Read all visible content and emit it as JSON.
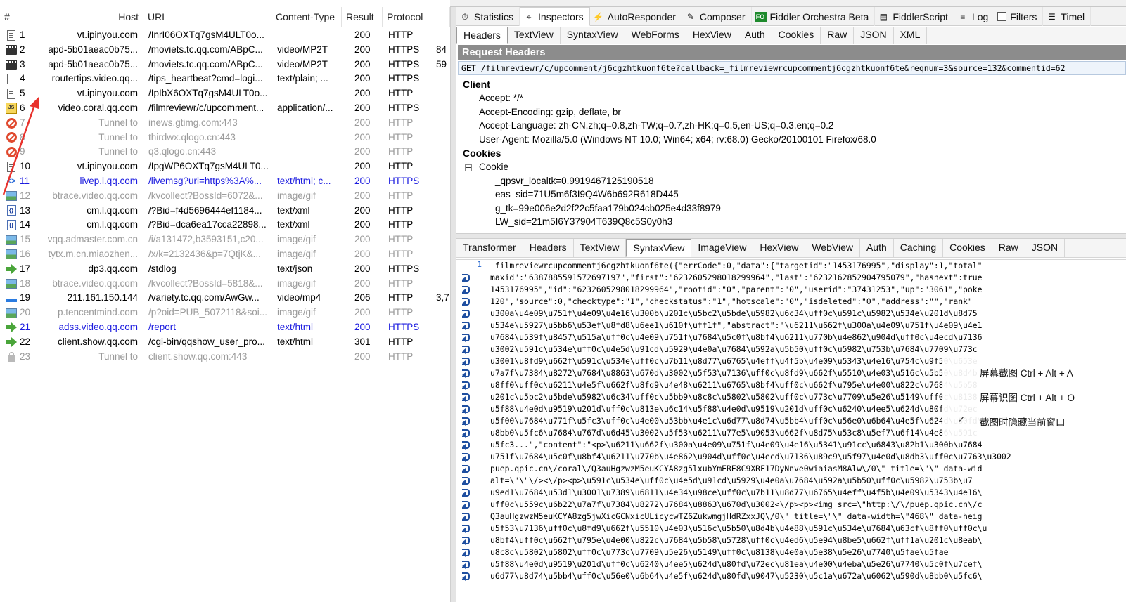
{
  "sessions": {
    "columns": [
      "#",
      "Host",
      "URL",
      "Content-Type",
      "Result",
      "Protocol"
    ],
    "rows": [
      {
        "icon": "document-icon",
        "num": "1",
        "host": "vt.ipinyou.com",
        "url": "/InrI06OXTq7gsM4ULT0o...",
        "ct": "",
        "result": "200",
        "proto": "HTTP",
        "extra": "",
        "state": "normal"
      },
      {
        "icon": "video-icon",
        "num": "2",
        "host": "apd-5b01aeac0b75...",
        "url": "/moviets.tc.qq.com/ABpC...",
        "ct": "video/MP2T",
        "result": "200",
        "proto": "HTTPS",
        "extra": "84",
        "state": "normal"
      },
      {
        "icon": "video-icon",
        "num": "3",
        "host": "apd-5b01aeac0b75...",
        "url": "/moviets.tc.qq.com/ABpC...",
        "ct": "video/MP2T",
        "result": "200",
        "proto": "HTTPS",
        "extra": "59",
        "state": "normal"
      },
      {
        "icon": "document-icon",
        "num": "4",
        "host": "routertips.video.qq...",
        "url": "/tips_heartbeat?cmd=logi...",
        "ct": "text/plain; ...",
        "result": "200",
        "proto": "HTTPS",
        "extra": "",
        "state": "normal"
      },
      {
        "icon": "document-icon",
        "num": "5",
        "host": "vt.ipinyou.com",
        "url": "/IpIbX6OXTq7gsM4ULT0o...",
        "ct": "",
        "result": "200",
        "proto": "HTTP",
        "extra": "",
        "state": "normal"
      },
      {
        "icon": "javascript-icon",
        "num": "6",
        "host": "video.coral.qq.com",
        "url": "/filmreviewr/c/upcomment...",
        "ct": "application/...",
        "result": "200",
        "proto": "HTTPS",
        "extra": "",
        "state": "selected"
      },
      {
        "icon": "blocked-icon",
        "num": "7",
        "host": "Tunnel to",
        "url": "inews.gtimg.com:443",
        "ct": "",
        "result": "200",
        "proto": "HTTP",
        "extra": "",
        "state": "muted"
      },
      {
        "icon": "blocked-icon",
        "num": "8",
        "host": "Tunnel to",
        "url": "thirdwx.qlogo.cn:443",
        "ct": "",
        "result": "200",
        "proto": "HTTP",
        "extra": "",
        "state": "muted"
      },
      {
        "icon": "blocked-icon",
        "num": "9",
        "host": "Tunnel to",
        "url": "q3.qlogo.cn:443",
        "ct": "",
        "result": "200",
        "proto": "HTTP",
        "extra": "",
        "state": "muted"
      },
      {
        "icon": "document-icon",
        "num": "10",
        "host": "vt.ipinyou.com",
        "url": "/IpgWP6OXTq7gsM4ULT0...",
        "ct": "",
        "result": "200",
        "proto": "HTTP",
        "extra": "",
        "state": "normal"
      },
      {
        "icon": "html-icon",
        "num": "11",
        "host": "livep.l.qq.com",
        "url": "/livemsg?url=https%3A%...",
        "ct": "text/html; c...",
        "result": "200",
        "proto": "HTTPS",
        "extra": "",
        "state": "blue"
      },
      {
        "icon": "image-icon",
        "num": "12",
        "host": "btrace.video.qq.com",
        "url": "/kvcollect?BossId=6072&...",
        "ct": "image/gif",
        "result": "200",
        "proto": "HTTP",
        "extra": "",
        "state": "muted"
      },
      {
        "icon": "xml-icon",
        "num": "13",
        "host": "cm.l.qq.com",
        "url": "/?Bid=f4d5696444ef1184...",
        "ct": "text/xml",
        "result": "200",
        "proto": "HTTP",
        "extra": "",
        "state": "normal"
      },
      {
        "icon": "xml-icon",
        "num": "14",
        "host": "cm.l.qq.com",
        "url": "/?Bid=dca6ea17cca22898...",
        "ct": "text/xml",
        "result": "200",
        "proto": "HTTP",
        "extra": "",
        "state": "normal"
      },
      {
        "icon": "image-icon",
        "num": "15",
        "host": "vqq.admaster.com.cn",
        "url": "/i/a131472,b3593151,c20...",
        "ct": "image/gif",
        "result": "200",
        "proto": "HTTP",
        "extra": "",
        "state": "muted"
      },
      {
        "icon": "image-icon",
        "num": "16",
        "host": "tytx.m.cn.miaozhen...",
        "url": "/x/k=2132436&p=7QtjK&...",
        "ct": "image/gif",
        "result": "200",
        "proto": "HTTP",
        "extra": "",
        "state": "muted"
      },
      {
        "icon": "arrow-icon",
        "num": "17",
        "host": "dp3.qq.com",
        "url": "/stdlog",
        "ct": "text/json",
        "result": "200",
        "proto": "HTTPS",
        "extra": "",
        "state": "normal"
      },
      {
        "icon": "image-icon",
        "num": "18",
        "host": "btrace.video.qq.com",
        "url": "/kvcollect?BossId=5818&...",
        "ct": "image/gif",
        "result": "200",
        "proto": "HTTP",
        "extra": "",
        "state": "muted"
      },
      {
        "icon": "media-icon",
        "num": "19",
        "host": "211.161.150.144",
        "url": "/variety.tc.qq.com/AwGw...",
        "ct": "video/mp4",
        "result": "206",
        "proto": "HTTP",
        "extra": "3,7",
        "state": "normal"
      },
      {
        "icon": "image-icon",
        "num": "20",
        "host": "p.tencentmind.com",
        "url": "/p?oid=PUB_5072118&soi...",
        "ct": "image/gif",
        "result": "200",
        "proto": "HTTP",
        "extra": "",
        "state": "muted"
      },
      {
        "icon": "arrow-icon",
        "num": "21",
        "host": "adss.video.qq.com",
        "url": "/report",
        "ct": "text/html",
        "result": "200",
        "proto": "HTTPS",
        "extra": "",
        "state": "blue"
      },
      {
        "icon": "arrow-icon",
        "num": "22",
        "host": "client.show.qq.com",
        "url": "/cgi-bin/qqshow_user_pro...",
        "ct": "text/html",
        "result": "301",
        "proto": "HTTP",
        "extra": "",
        "state": "normal"
      },
      {
        "icon": "lock-icon",
        "num": "23",
        "host": "Tunnel to",
        "url": "client.show.qq.com:443",
        "ct": "",
        "result": "200",
        "proto": "HTTP",
        "extra": "",
        "state": "muted"
      }
    ]
  },
  "main_tabs": [
    {
      "label": "Statistics",
      "icon": "stopwatch-icon",
      "active": false
    },
    {
      "label": "Inspectors",
      "icon": "inspect-icon",
      "active": true
    },
    {
      "label": "AutoResponder",
      "icon": "lightning-icon",
      "active": false
    },
    {
      "label": "Composer",
      "icon": "pencil-icon",
      "active": false
    },
    {
      "label": "Fiddler Orchestra Beta",
      "icon": "fo-icon",
      "active": false
    },
    {
      "label": "FiddlerScript",
      "icon": "script-icon",
      "active": false
    },
    {
      "label": "Log",
      "icon": "log-icon",
      "active": false
    },
    {
      "label": "Filters",
      "icon": "checkbox-icon",
      "active": false
    },
    {
      "label": "Timel",
      "icon": "timeline-icon",
      "active": false
    }
  ],
  "request_tabs": [
    "Headers",
    "TextView",
    "SyntaxView",
    "WebForms",
    "HexView",
    "Auth",
    "Cookies",
    "Raw",
    "JSON",
    "XML"
  ],
  "request": {
    "title": "Request Headers",
    "request_line": "GET /filmreviewr/c/upcomment/j6cgzhtkuonf6te?callback=_filmreviewrcupcommentj6cgzhtkuonf6te&reqnum=3&source=132&commentid=62",
    "client_title": "Client",
    "client_headers": [
      "Accept: */*",
      "Accept-Encoding: gzip, deflate, br",
      "Accept-Language: zh-CN,zh;q=0.8,zh-TW;q=0.7,zh-HK;q=0.5,en-US;q=0.3,en;q=0.2",
      "User-Agent: Mozilla/5.0 (Windows NT 10.0; Win64; x64; rv:68.0) Gecko/20100101 Firefox/68.0"
    ],
    "cookies_title": "Cookies",
    "cookie_node": "Cookie",
    "cookies": [
      "_qpsvr_localtk=0.9919467125190518",
      "eas_sid=71U5m6f3I9Q4W6b692R618D445",
      "g_tk=99e006e2d2f22c5faa179b024cb025e4d33f8979",
      "LW_sid=21m5I6Y37904T639Q8c5S0y0h3"
    ]
  },
  "response_tabs": [
    "Transformer",
    "Headers",
    "TextView",
    "SyntaxView",
    "ImageView",
    "HexView",
    "WebView",
    "Auth",
    "Caching",
    "Cookies",
    "Raw",
    "JSON"
  ],
  "response_active_tab": "SyntaxView",
  "response_lines": [
    "_filmreviewrcupcommentj6cgzhtkuonf6te({\"errCode\":0,\"data\":{\"targetid\":\"1453176995\",\"display\":1,\"total\"",
    "maxid\":\"6387885591572697197\",\"first\":\"6232605298018299964\",\"last\":\"6232162852904795079\",\"hasnext\":true",
    "1453176995\",\"id\":\"6232605298018299964\",\"rootid\":\"0\",\"parent\":\"0\",\"userid\":\"37431253\",\"up\":\"3061\",\"poke",
    "120\",\"source\":0,\"checktype\":\"1\",\"checkstatus\":\"1\",\"hotscale\":\"0\",\"isdeleted\":\"0\",\"address\":\"\",\"rank\"",
    "u300a\\u4e09\\u751f\\u4e09\\u4e16\\u300b\\u201c\\u5bc2\\u5bde\\u5982\\u6c34\\uff0c\\u591c\\u5982\\u534e\\u201d\\u8d75",
    "u534e\\u5927\\u5bb6\\u53ef\\u8fd8\\u6ee1\\u610f\\uff1f\",\"abstract\":\"\\u6211\\u662f\\u300a\\u4e09\\u751f\\u4e09\\u4e1",
    "u7684\\u539f\\u8457\\u515a\\uff0c\\u4e09\\u751f\\u7684\\u5c0f\\u8bf4\\u6211\\u770b\\u4e862\\u904d\\uff0c\\u4ecd\\u7136",
    "u3002\\u591c\\u534e\\uff0c\\u4e5d\\u91cd\\u5929\\u4e0a\\u7684\\u592a\\u5b50\\uff0c\\u5982\\u753b\\u7684\\u7709\\u773c",
    "u3001\\u8fd9\\u662f\\u591c\\u534e\\uff0c\\u7b11\\u8d77\\u6765\\u4eff\\u4f5b\\u4e09\\u5343\\u4e16\\u754c\\u9f50\\u653e",
    "u7a7f\\u7384\\u8272\\u7684\\u8863\\u670d\\u3002\\u5f53\\u7136\\uff0c\\u8fd9\\u662f\\u5510\\u4e03\\u516c\\u5b50\\u8d4b",
    "u8ff0\\uff0c\\u6211\\u4e5f\\u662f\\u8fd9\\u4e48\\u6211\\u6765\\u8bf4\\uff0c\\u662f\\u795e\\u4e00\\u822c\\u7684\\u5b58",
    "u201c\\u5bc2\\u5bde\\u5982\\u6c34\\uff0c\\u5bb9\\u8c8c\\u5802\\u5802\\uff0c\\u773c\\u7709\\u5e26\\u5149\\uff0c\\u8138",
    "u5f88\\u4e0d\\u9519\\u201d\\uff0c\\u813e\\u6c14\\u5f88\\u4e0d\\u9519\\u201d\\uff0c\\u6240\\u4ee5\\u624d\\u80fd\\u72ec",
    "u5f00\\u7684\\u771f\\u5fc3\\uff0c\\u4e00\\u53bb\\u4e1c\\u6d77\\u8d74\\u5bb4\\uff0c\\u56e0\\u6b64\\u4e5f\\u624d\\u80fd\\u9047",
    "u8bb0\\u5fc6\\u7684\\u767d\\u6d45\\u3002\\u5f53\\u6211\\u77e5\\u9053\\u662f\\u8d75\\u53c8\\u5ef7\\u6f14\\u4e86\\u591c",
    "u5fc3...\",\"content\":\"<p>\\u6211\\u662f\\u300a\\u4e09\\u751f\\u4e09\\u4e16\\u5341\\u91cc\\u6843\\u82b1\\u300b\\u7684",
    "u751f\\u7684\\u5c0f\\u8bf4\\u6211\\u770b\\u4e862\\u904d\\uff0c\\u4ecd\\u7136\\u89c9\\u5f97\\u4e0d\\u8db3\\uff0c\\u7763\\u3002",
    "puep.qpic.cn\\/coral\\/Q3auHgzwzM5euKCYA8zg5lxubYmERE8C9XRF17DyNnve0wiaiasM8Alw\\/0\\\" title=\\\"\\\" data-wid",
    " alt=\\\"\\\"\\/><\\/p><p>\\u591c\\u534e\\uff0c\\u4e5d\\u91cd\\u5929\\u4e0a\\u7684\\u592a\\u5b50\\uff0c\\u5982\\u753b\\u7",
    "u9ed1\\u7684\\u53d1\\u3001\\u7389\\u6811\\u4e34\\u98ce\\uff0c\\u7b11\\u8d77\\u6765\\u4eff\\u4f5b\\u4e09\\u5343\\u4e16\\",
    "uff0c\\u559c\\u6b22\\u7a7f\\u7384\\u8272\\u7684\\u8863\\u670d\\u3002<\\/p><p><img src=\\\"http:\\/\\/puep.qpic.cn\\/c",
    "Q3auHgzwzM5euKCYA8zg5jwXicGCNxicULicycwTZ6ZukwmgjHdRZxxJQ\\/0\\\" title=\\\"\\\" data-width=\\\"468\\\" data-heig",
    "u5f53\\u7136\\uff0c\\u8fd9\\u662f\\u5510\\u4e03\\u516c\\u5b50\\u8d4b\\u4e88\\u591c\\u534e\\u7684\\u63cf\\u8ff0\\uff0c\\u",
    "u8bf4\\uff0c\\u662f\\u795e\\u4e00\\u822c\\u7684\\u5b58\\u5728\\uff0c\\u4ed6\\u5e94\\u8be5\\u662f\\uff1a\\u201c\\u8eab\\",
    "u8c8c\\u5802\\u5802\\uff0c\\u773c\\u7709\\u5e26\\u5149\\uff0c\\u8138\\u4e0a\\u5e38\\u5e26\\u7740\\u5fae\\u5fae",
    "u5f88\\u4e0d\\u9519\\u201d\\uff0c\\u6240\\u4ee5\\u624d\\u80fd\\u72ec\\u81ea\\u4e00\\u4eba\\u5e26\\u7740\\u5c0f\\u7cef\\",
    "u6d77\\u8d74\\u5bb4\\uff0c\\u56e0\\u6b64\\u4e5f\\u624d\\u80fd\\u9047\\u5230\\u5c1a\\u672a\\u6062\\u590d\\u8bb0\\u5fc6\\"
  ],
  "context_menu": {
    "items": [
      "屏幕截图 Ctrl + Alt + A",
      "屏幕识图 Ctrl + Alt + O",
      "截图时隐藏当前窗口"
    ],
    "checked_index": 2
  },
  "colors": {
    "selected_row": "#f1f1f1",
    "muted_text": "#9b9b9b",
    "link_blue": "#1b1bdf",
    "request_title_bg": "#8c8c8c",
    "annotation_arrow": "#e8322c"
  }
}
